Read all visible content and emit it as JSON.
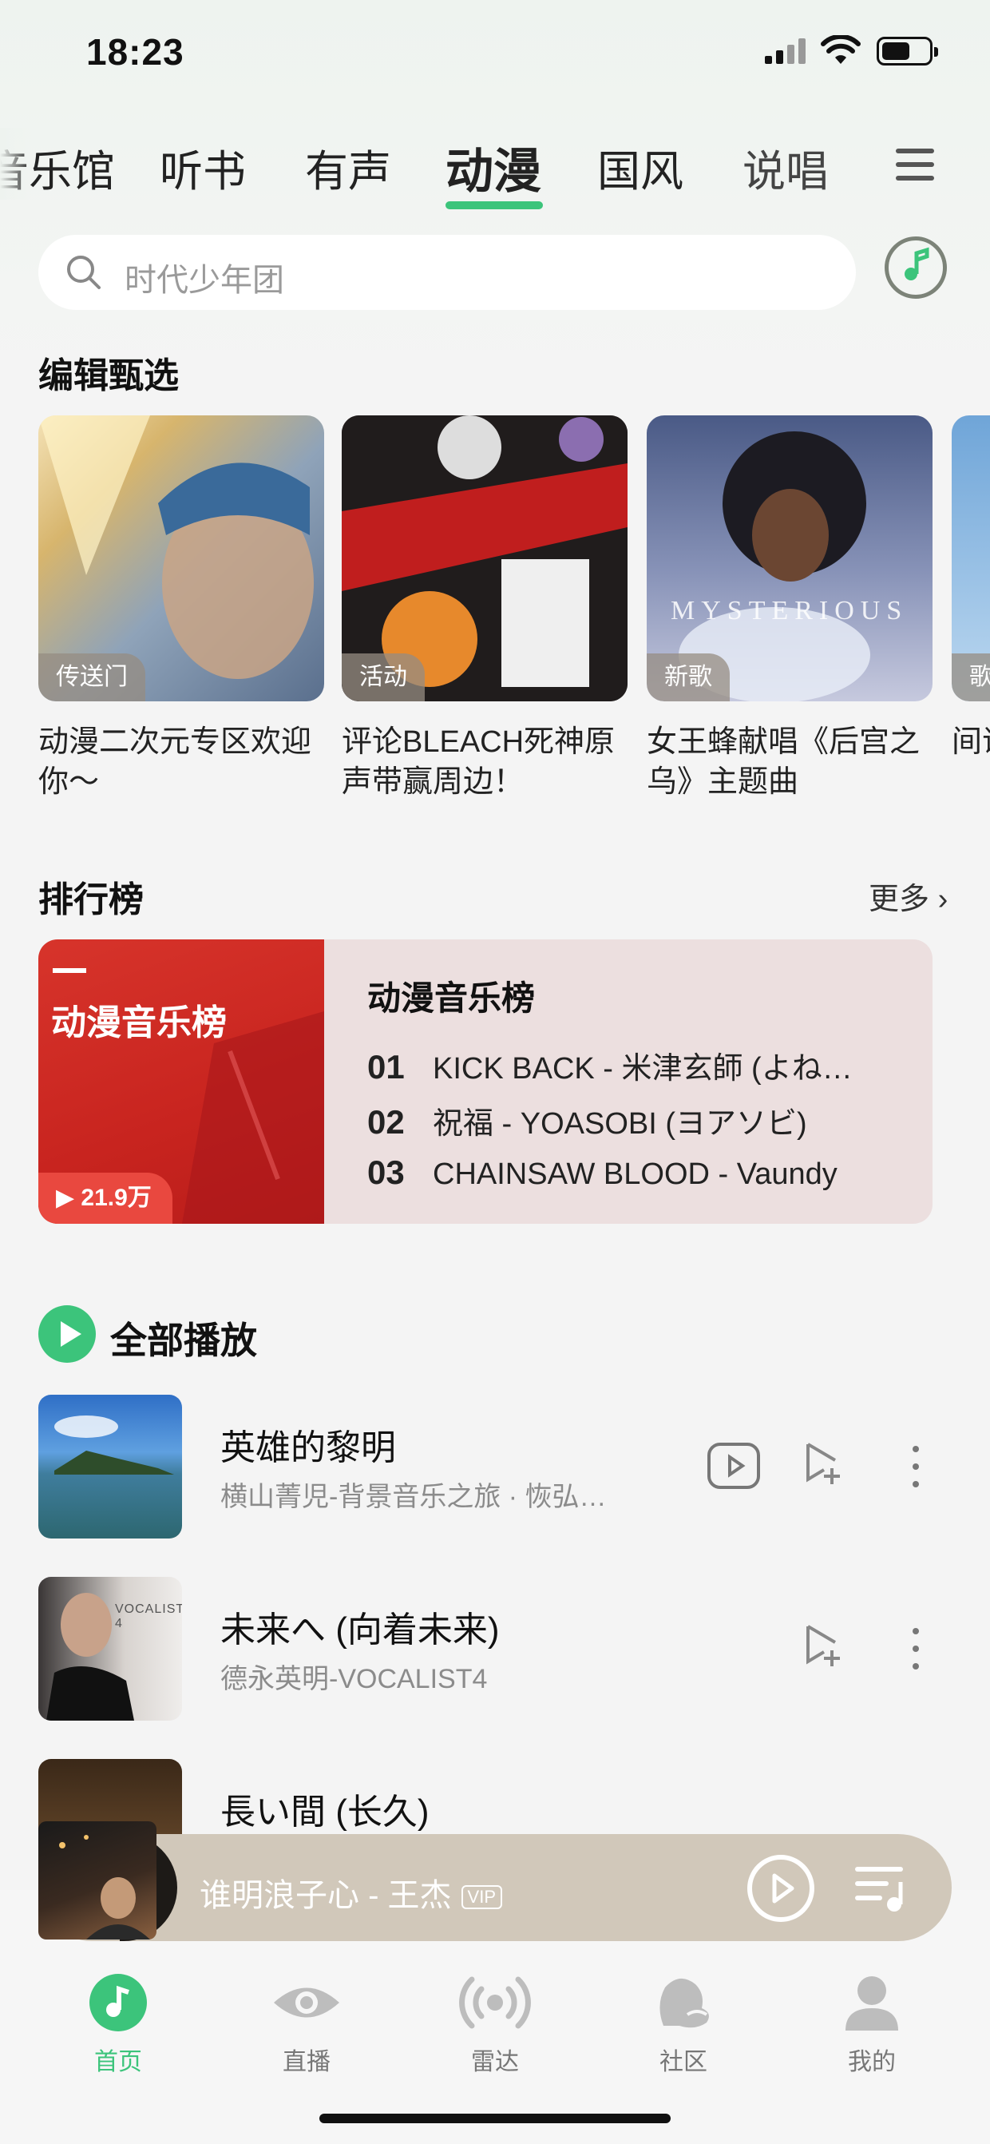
{
  "status_bar": {
    "time": "18:23"
  },
  "tabs": [
    {
      "label": "音乐馆",
      "active": false
    },
    {
      "label": "听书",
      "active": false
    },
    {
      "label": "有声",
      "active": false
    },
    {
      "label": "动漫",
      "active": true
    },
    {
      "label": "国风",
      "active": false
    },
    {
      "label": "说唱",
      "active": false
    }
  ],
  "search": {
    "placeholder": "时代少年团"
  },
  "editor_picks": {
    "title": "编辑甄选",
    "items": [
      {
        "tag": "传送门",
        "caption": "动漫二次元专区欢迎你～"
      },
      {
        "tag": "活动",
        "caption": "评论BLEACH死神原声带赢周边！"
      },
      {
        "tag": "新歌",
        "caption": "女王蜂献唱《后宫之乌》主题曲",
        "cover_text": "MYSTERIOUS"
      },
      {
        "tag": "歌",
        "caption": "间谍OP"
      }
    ]
  },
  "rankings": {
    "title": "排行榜",
    "more": "更多",
    "chart": {
      "cover_title": "动漫音乐榜",
      "plays": "21.9万",
      "name": "动漫音乐榜",
      "rows": [
        {
          "rank": "01",
          "text": "KICK BACK - 米津玄師 (よね…"
        },
        {
          "rank": "02",
          "text": "祝福 - YOASOBI (ヨアソビ)"
        },
        {
          "rank": "03",
          "text": "CHAINSAW BLOOD - Vaundy"
        }
      ]
    }
  },
  "play_all": {
    "label": "全部播放"
  },
  "songs": [
    {
      "title": "英雄的黎明",
      "subtitle": "横山菁児-背景音乐之旅 · 恢弘…",
      "has_video": true
    },
    {
      "title": "未来へ (向着未来)",
      "subtitle": "德永英明-VOCALIST4",
      "cover_text": "VOCALIST 4",
      "has_video": false
    },
    {
      "title": "長い間 (长久)",
      "subtitle": "",
      "has_video": false
    }
  ],
  "mini_player": {
    "text": "谁明浪子心 - 王杰",
    "badge": "VIP"
  },
  "bottom_nav": [
    {
      "label": "首页",
      "icon": "music-note-icon",
      "active": true
    },
    {
      "label": "直播",
      "icon": "eye-icon",
      "active": false
    },
    {
      "label": "雷达",
      "icon": "radar-icon",
      "active": false
    },
    {
      "label": "社区",
      "icon": "community-icon",
      "active": false
    },
    {
      "label": "我的",
      "icon": "person-icon",
      "active": false
    }
  ],
  "colors": {
    "accent": "#3cc47b",
    "chart_red": "#d7342b",
    "player_bg": "#d1c8ba"
  }
}
